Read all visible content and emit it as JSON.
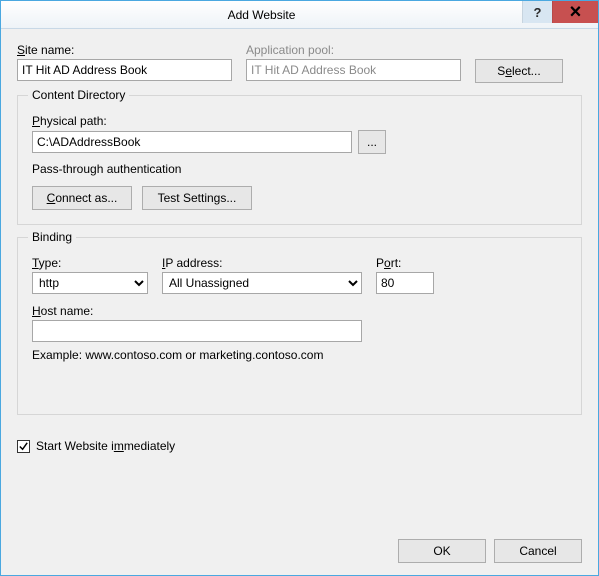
{
  "titlebar": {
    "title": "Add Website",
    "help": "?",
    "close": "🗙"
  },
  "site": {
    "name_label": "Site name:",
    "name_value": "IT Hit AD Address Book",
    "app_pool_label": "Application pool:",
    "app_pool_value": "IT Hit AD Address Book",
    "select_label": "Select..."
  },
  "content_dir": {
    "legend": "Content Directory",
    "path_label": "Physical path:",
    "path_value": "C:\\ADAddressBook",
    "browse_label": "...",
    "auth_label": "Pass-through authentication",
    "connect_as_label": "Connect as...",
    "test_settings_label": "Test Settings..."
  },
  "binding": {
    "legend": "Binding",
    "type_label": "Type:",
    "type_value": "http",
    "ip_label": "IP address:",
    "ip_value": "All Unassigned",
    "port_label": "Port:",
    "port_value": "80",
    "host_label": "Host name:",
    "host_value": "",
    "example": "Example: www.contoso.com or marketing.contoso.com"
  },
  "start_checkbox": {
    "label_before": "Start Website i",
    "label_underline": "m",
    "label_after": "mediately"
  },
  "footer": {
    "ok": "OK",
    "cancel": "Cancel"
  }
}
